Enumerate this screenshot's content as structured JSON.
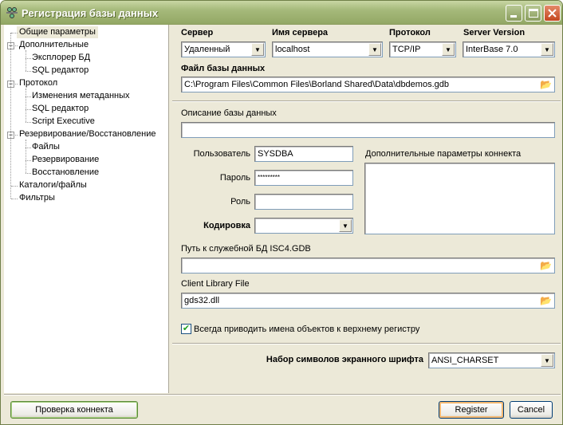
{
  "window": {
    "title": "Регистрация базы данных"
  },
  "tree": {
    "items": [
      {
        "label": "Общие параметры",
        "level": 0,
        "selected": true
      },
      {
        "label": "Дополнительные",
        "level": 0,
        "expandable": true
      },
      {
        "label": "Эксплорер БД",
        "level": 1
      },
      {
        "label": "SQL редактор",
        "level": 1
      },
      {
        "label": "Протокол",
        "level": 0,
        "expandable": true
      },
      {
        "label": "Изменения метаданных",
        "level": 1
      },
      {
        "label": "SQL редактор",
        "level": 1
      },
      {
        "label": "Script Executive",
        "level": 1
      },
      {
        "label": "Резервирование/Восстановление",
        "level": 0,
        "expandable": true
      },
      {
        "label": "Файлы",
        "level": 1
      },
      {
        "label": "Резервирование",
        "level": 1
      },
      {
        "label": "Восстановление",
        "level": 1
      },
      {
        "label": "Каталоги/файлы",
        "level": 0
      },
      {
        "label": "Фильтры",
        "level": 0
      }
    ]
  },
  "form": {
    "server": {
      "label": "Сервер",
      "value": "Удаленный"
    },
    "server_name": {
      "label": "Имя сервера",
      "value": "localhost"
    },
    "protocol": {
      "label": "Протокол",
      "value": "TCP/IP"
    },
    "server_version": {
      "label": "Server Version",
      "value": "InterBase 7.0"
    },
    "db_file": {
      "label": "Файл базы данных",
      "value": "C:\\Program Files\\Common Files\\Borland Shared\\Data\\dbdemos.gdb"
    },
    "description": {
      "label": "Описание базы данных",
      "value": ""
    },
    "user": {
      "label": "Пользователь",
      "value": "SYSDBA"
    },
    "password": {
      "label": "Пароль",
      "value": "*********"
    },
    "role": {
      "label": "Роль",
      "value": ""
    },
    "charset": {
      "label": "Кодировка",
      "value": ""
    },
    "extra_params": {
      "label": "Дополнительные параметры коннекта",
      "value": ""
    },
    "isc4_path": {
      "label": "Путь к служебной БД ISC4.GDB",
      "value": ""
    },
    "client_lib": {
      "label": "Client Library File",
      "value": "gds32.dll"
    },
    "uppercase": {
      "label": "Всегда приводить имена объектов к верхнему регистру",
      "checked": true
    },
    "font_charset": {
      "label": "Набор символов экранного шрифта",
      "value": "ANSI_CHARSET"
    }
  },
  "buttons": {
    "test": "Проверка коннекта",
    "register": "Register",
    "cancel": "Cancel"
  }
}
